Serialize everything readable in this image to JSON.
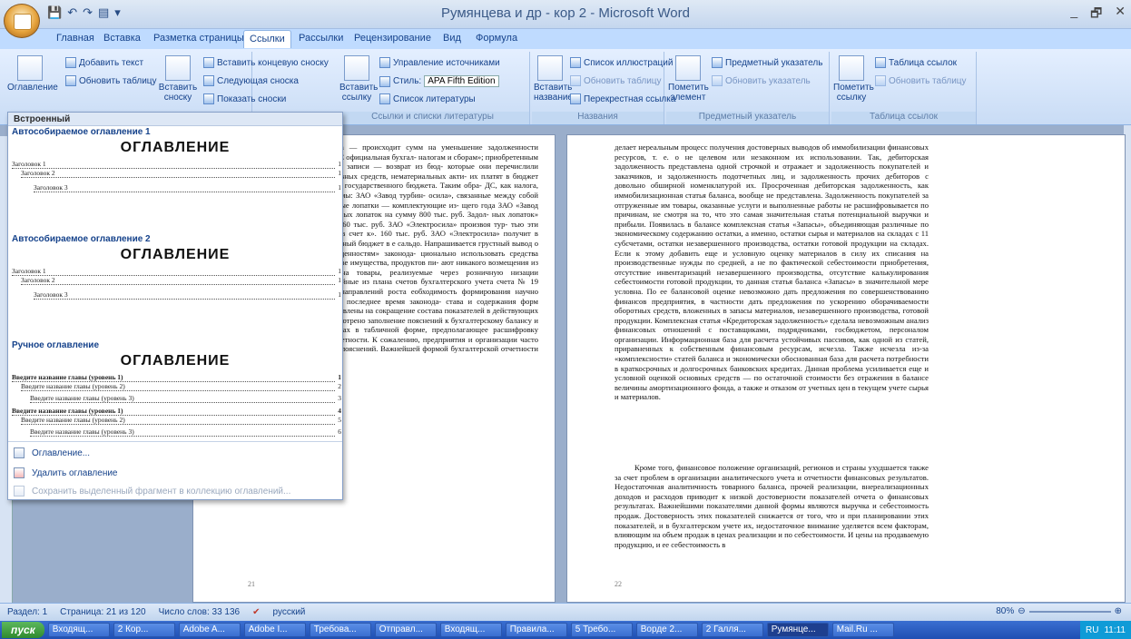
{
  "window": {
    "title": "Румянцева и др - кор 2 - Microsoft Word",
    "controls": [
      "_",
      "🗗",
      "✕"
    ]
  },
  "qat": [
    "💾",
    "↶",
    "↷",
    "▤",
    "▾"
  ],
  "tabs": [
    "Главная",
    "Вставка",
    "Разметка страницы",
    "Ссылки",
    "Рассылки",
    "Рецензирование",
    "Вид",
    "Формула"
  ],
  "ribbon": {
    "toc": {
      "big": "Оглавление",
      "add_text": "Добавить текст",
      "update": "Обновить таблицу"
    },
    "footnotes": {
      "insert": "Вставить сноску",
      "insert_end": "Вставить концевую сноску",
      "next": "Следующая сноска",
      "show": "Показать сноски"
    },
    "citations": {
      "insert": "Вставить ссылку",
      "manage": "Управление источниками",
      "style_label": "Стиль:",
      "style_value": "APA Fifth Edition",
      "bib": "Список литературы",
      "group": "Ссылки и списки литературы"
    },
    "captions": {
      "insert": "Вставить название",
      "list": "Список иллюстраций",
      "update": "Обновить таблицу",
      "cross": "Перекрестная ссылка",
      "group": "Названия"
    },
    "index": {
      "mark": "Пометить элемент",
      "insert": "Предметный указатель",
      "update": "Обновить указатель",
      "group": "Предметный указатель"
    },
    "toa": {
      "mark": "Пометить ссылку",
      "insert": "Таблица ссылок",
      "update": "Обновить таблицу",
      "group": "Таблица ссылок"
    }
  },
  "dropdown": {
    "header": "Встроенный",
    "sections": [
      {
        "name": "Автособираемое оглавление 1",
        "heading": "ОГЛАВЛЕНИЕ",
        "lines": [
          [
            "Заголовок 1",
            "1"
          ],
          [
            "Заголовок 2",
            "1"
          ],
          [
            "Заголовок 3",
            "1"
          ]
        ]
      },
      {
        "name": "Автособираемое оглавление 2",
        "heading": "ОГЛАВЛЕНИЕ",
        "lines": [
          [
            "Заголовок 1",
            "1"
          ],
          [
            "Заголовок 2",
            "1"
          ],
          [
            "Заголовок 3",
            "1"
          ]
        ]
      },
      {
        "name": "Ручное оглавление",
        "heading": "ОГЛАВЛЕНИЕ",
        "lines": [
          [
            "Введите название главы (уровень 1)",
            "1"
          ],
          [
            "Введите название главы (уровень 2)",
            "2"
          ],
          [
            "Введите название главы (уровень 3)",
            "3"
          ],
          [
            "Введите название главы (уровень 1)",
            "4"
          ],
          [
            "Введите название главы (уровень 2)",
            "5"
          ],
          [
            "Введите название главы (уровень 3)",
            "6"
          ]
        ]
      }
    ],
    "menu": [
      "Оглавление...",
      "Удалить оглавление",
      "Сохранить выделенный фрагмент в коллекцию оглавлений..."
    ]
  },
  "page1": {
    "number": "21",
    "text": "ценностям, а по кредиту счета — происходит сумм на уменьшение задолженности государст- на списание этого НДС официальная бухгал- налогам и сборам»; приобретенным ценностям». этой бухгалтерской записи — возврат из бюд- которые они перечислили поставщикам при оп- тели основных средств, нематериальных акти- их платят в бюджет НДС, то покупатели этой ние из государственного бюджета. Таким обра- ДС, как налога, исчезает. кт-Петербурге две фирмы: ЗАО «Завод турбин- осила», связанные между собой постоянными по- сила» турбинные лопатки — комплектующие из- щего года ЗАО «Завод турбинных лопаток» по- турбинных лопаток на сумму 800 тыс. руб. Задол- ных лопаток» бюджету составила, например, 160 тыс. руб. ЗАО «Электросила» произвоя тур- тью эти лопатки, предварительно оплатив счет к». 160 тыс. руб. ЗАО «Электросила» получит в ственного бюджета. Государственный бюджет в е сальдо. Напрашивается грустный вывод о том, НДС по приобретенным ценностям» законода- ционально использовать средства государствен- ии при производстве имущества, продуктов пи- ают никакого возмещения из госбюджета, а по- ы цен на товары, реализуемые через розничную низации налогообложения действуют двойные из плана счетов бухгалтерского учета счета № 19 енностям» является одним из направлений роста еобходимость формирования научно обоснован- и. Произошедшие в последнее время законода- става и содержания форм бухгалтерской отчет- ности направлены на сокращение состава показателей в действующих формах отчетности, хотя предусмотрено заполнение пояснений к бухгалтерскому балансу и отчету о финансовых результатах в табличной форме, предполагающее расшифровку каждой статьи данных форм отчетности. К сожалению, предприятия и организации часто пренебрегают заполнением этих пояснений. Важнейшей формой бухгалтерской отчетности является бухгалтерский баланс,"
  },
  "page2": {
    "number": "22",
    "p1": "делает нереальным процесс получения достоверных выводов об иммобилизации финансовых ресурсов, т. е. о не целевом или незаконном их использовании. Так, дебиторская задолженность представлена одной строчкой и отражает и задолженность покупателей и заказчиков, и задолженность подотчетных лиц, и задолженность прочих дебиторов с довольно обширной номенклатурой их. Просроченная дебиторская задолженность, как иммобилизационная статья баланса, вообще не представлена. Задолженность покупателей за отгруженные им товары, оказанные услуги и выполненные работы не расшифровывается по причинам, не смотря на то, что это самая значительная статья потенциальной выручки и прибыли. Появилась в балансе комплексная статья «Запасы», объединяющая различные по экономическому содержанию остатки, а именно, остатки сырья и материалов на складах с 11 субсчетами, остатки незавершенного производства, остатки готовой продукции на складах. Если к этому добавить еще и условную оценку материалов в силу их списания на производственные нужды по средней, а не по фактической себестоимости приобретения, отсутствие инвентаризаций незавершенного производства, отсутствие калькулирования себестоимости готовой продукции, то данная статья баланса «Запасы» в значительной мере условна. По ее балансовой оценке невозможно дать предложения по совершенствованию финансов предприятия, в частности дать предложения по ускорению оборачиваемости оборотных средств, вложенных в запасы материалов, незавершенного производства, готовой продукции. Комплексная статья «Кредиторская задолженность» сделала невозможным анализ финансовых отношений с поставщиками, подрядчиками, госбюджетом, персоналом организации. Информационная база для расчета устойчивых пассивов, как одной из статей, приравненных к собственным финансовым ресурсам, исчезла. Также исчезла из-за «комплексности» статей баланса и экономически обоснованная база для расчета потребности в краткосрочных и долгосрочных банковских кредитах. Данная проблема усиливается еще и условной оценкой основных средств — по остаточной стоимости без отражения в балансе величины амортизационного фонда, а также и отказом от учетных цен в текущем учете сырья и материалов.",
    "p2": "Кроме того, финансовое положение организаций, регионов и страны ухудшается также за счет проблем в организации аналитического учета и отчетности финансовых результатов. Недостаточная аналитичность товарного баланса, прочей реализации, внереализационных доходов и расходов приводит к низкой достоверности показателей отчета о финансовых результатах. Важнейшими показателями данной формы являются выручка и себестоимость продаж. Достоверность этих показателей снижается от того, что и при планировании этих показателей, и в бухгалтерском учете их, недостаточное внимание уделяется всем факторам, влияющим на объем продаж в ценах реализации и по себестоимости. И цены на продаваемую продукцию, и ее себестоимость в"
  },
  "status": {
    "section": "Раздел: 1",
    "page": "Страница: 21 из 120",
    "words": "Число слов: 33 136",
    "lang": "русский",
    "zoom": "80%"
  },
  "taskbar": {
    "start": "пуск",
    "items": [
      "Входящ...",
      "2 Кор...",
      "Adobe A...",
      "Adobe I...",
      "Требова...",
      "Отправл...",
      "Входящ...",
      "Правила...",
      "5 Требо...",
      "Ворде 2...",
      "2 Галля...",
      "Румянце...",
      "Mail.Ru ..."
    ],
    "lang": "RU",
    "time": "11:11"
  }
}
